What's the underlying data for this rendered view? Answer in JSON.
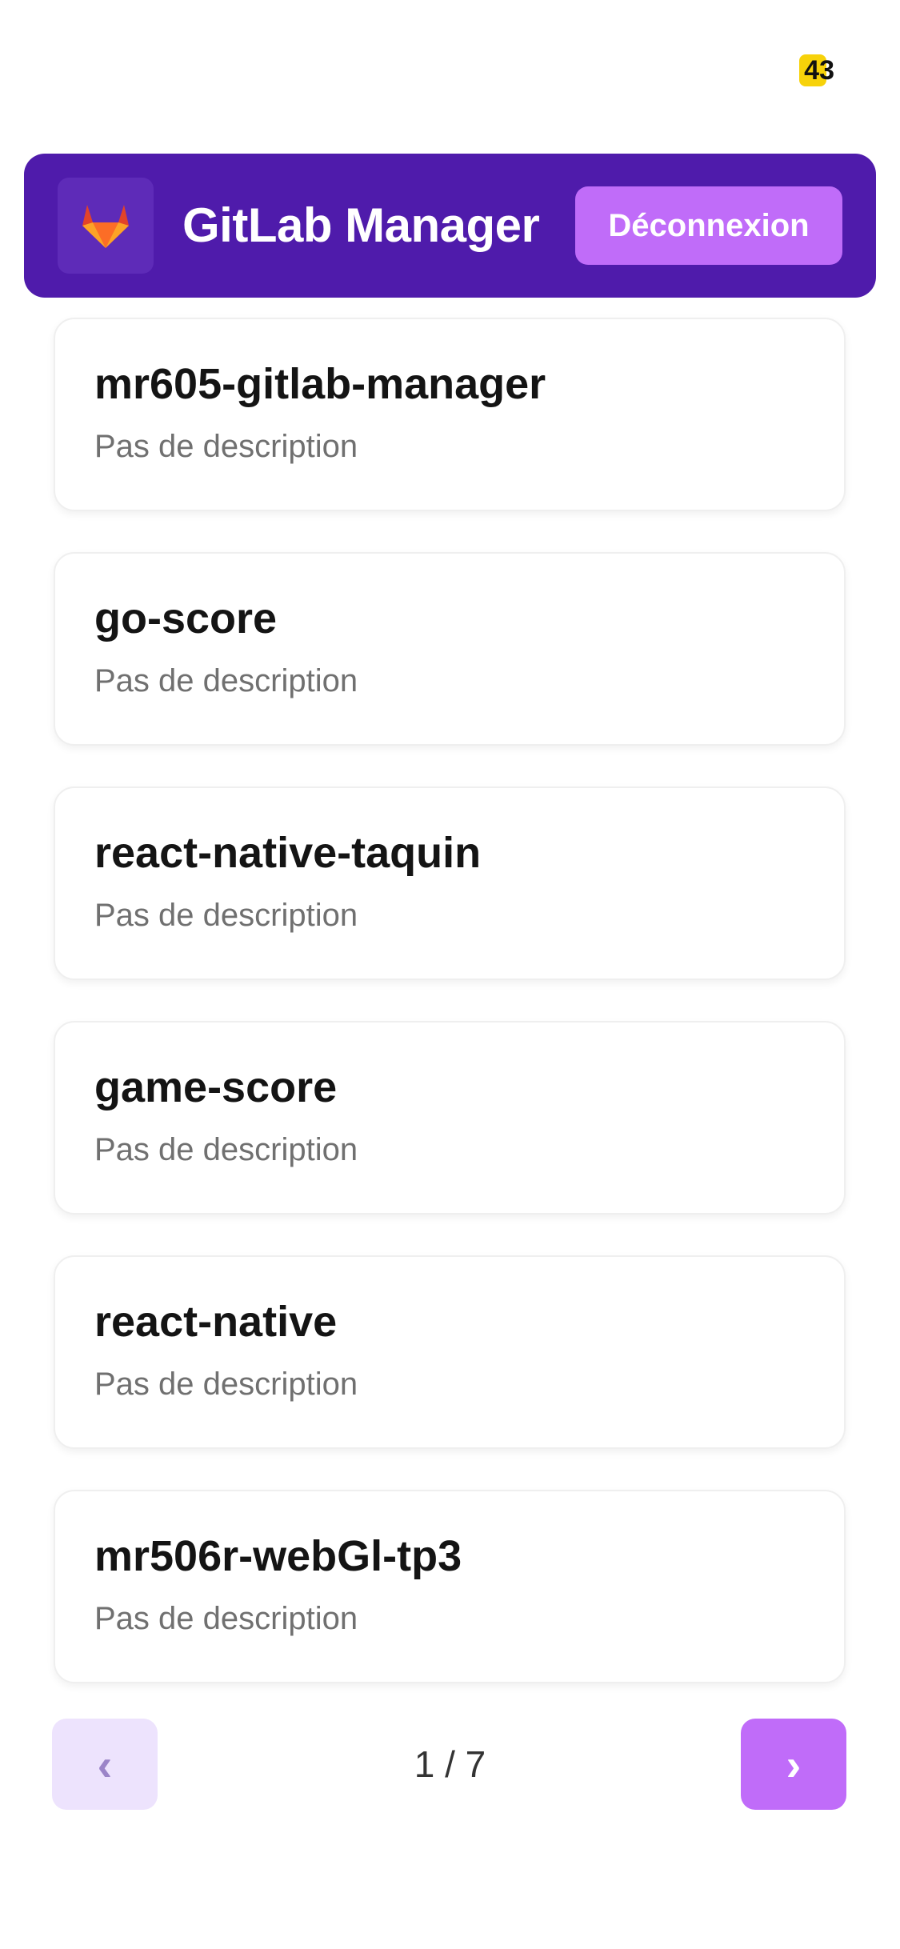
{
  "status_bar": {
    "battery_level": "43",
    "battery_color": "#f7d20a"
  },
  "header": {
    "title": "GitLab Manager",
    "logo_icon": "gitlab-fox-icon",
    "logout_label": "Déconnexion",
    "background_color": "#4f1bab",
    "accent_color": "#c06cf9"
  },
  "projects": [
    {
      "name": "mr605-gitlab-manager",
      "description": "Pas de description"
    },
    {
      "name": "go-score",
      "description": "Pas de description"
    },
    {
      "name": "react-native-taquin",
      "description": "Pas de description"
    },
    {
      "name": "game-score",
      "description": "Pas de description"
    },
    {
      "name": "react-native",
      "description": "Pas de description"
    },
    {
      "name": "mr506r-webGl-tp3",
      "description": "Pas de description"
    }
  ],
  "pagination": {
    "prev_label": "‹",
    "next_label": "›",
    "indicator": "1 / 7",
    "prev_icon": "chevron-left-icon",
    "next_icon": "chevron-right-icon"
  }
}
